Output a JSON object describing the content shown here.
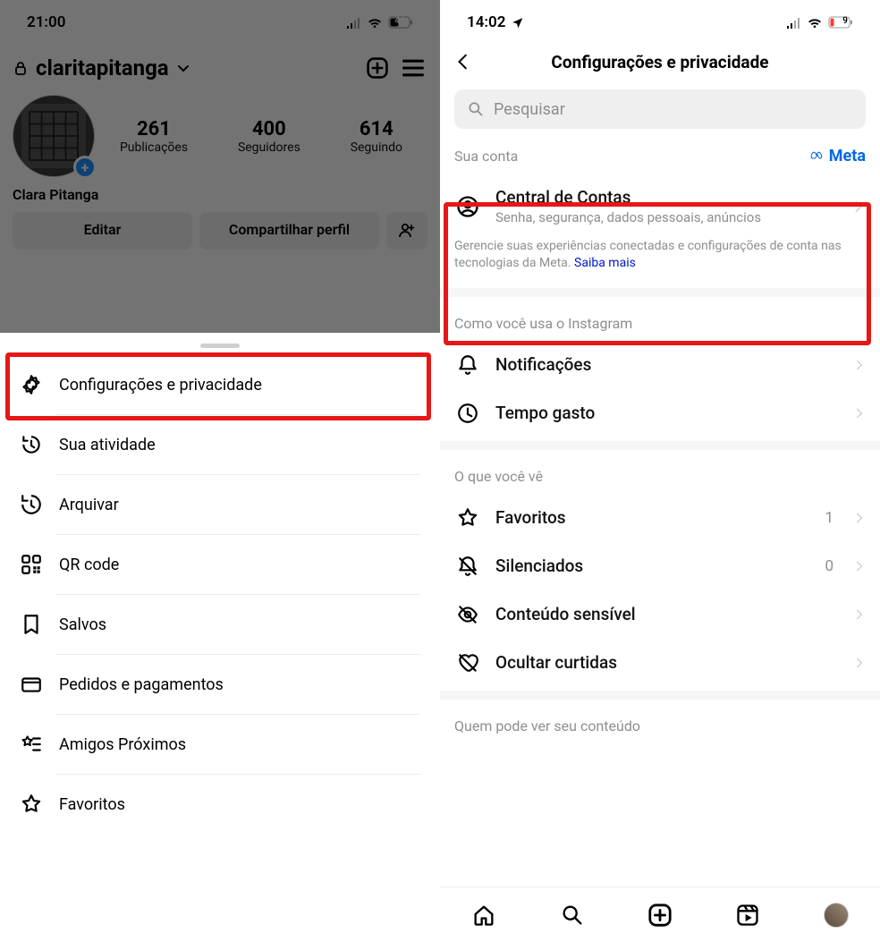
{
  "left": {
    "statusbar": {
      "time": "21:00",
      "battery": "44"
    },
    "username": "claritapitanga",
    "stats": {
      "posts": {
        "value": "261",
        "label": "Publicações"
      },
      "followers": {
        "value": "400",
        "label": "Seguidores"
      },
      "following": {
        "value": "614",
        "label": "Seguindo"
      }
    },
    "displayName": "Clara Pitanga",
    "buttons": {
      "edit": "Editar",
      "share": "Compartilhar perfil"
    },
    "sheet": [
      {
        "icon": "gear-icon",
        "label": "Configurações e privacidade"
      },
      {
        "icon": "clock-arrow-icon",
        "label": "Sua atividade"
      },
      {
        "icon": "archive-icon",
        "label": "Arquivar"
      },
      {
        "icon": "qr-icon",
        "label": "QR code"
      },
      {
        "icon": "bookmark-icon",
        "label": "Salvos"
      },
      {
        "icon": "card-icon",
        "label": "Pedidos e pagamentos"
      },
      {
        "icon": "star-list-icon",
        "label": "Amigos Próximos"
      },
      {
        "icon": "star-icon",
        "label": "Favoritos"
      }
    ]
  },
  "right": {
    "statusbar": {
      "time": "14:02",
      "battery": "9"
    },
    "title": "Configurações e privacidade",
    "search_placeholder": "Pesquisar",
    "account": {
      "label": "Sua conta",
      "brand": "Meta",
      "item": {
        "title": "Central de Contas",
        "subtitle": "Senha, segurança, dados pessoais, anúncios"
      },
      "helper_prefix": "Gerencie suas experiências conectadas e configurações de conta nas tecnologias da Meta. ",
      "helper_link": "Saiba mais"
    },
    "usage": {
      "label": "Como você usa o Instagram",
      "items": [
        {
          "icon": "bell-icon",
          "label": "Notificações"
        },
        {
          "icon": "clock-icon",
          "label": "Tempo gasto"
        }
      ]
    },
    "see": {
      "label": "O que você vê",
      "items": [
        {
          "icon": "star-icon",
          "label": "Favoritos",
          "count": "1"
        },
        {
          "icon": "bell-off-icon",
          "label": "Silenciados",
          "count": "0"
        },
        {
          "icon": "eye-off-icon",
          "label": "Conteúdo sensível"
        },
        {
          "icon": "heart-off-icon",
          "label": "Ocultar curtidas"
        }
      ]
    },
    "who": {
      "label": "Quem pode ver seu conteúdo"
    }
  }
}
